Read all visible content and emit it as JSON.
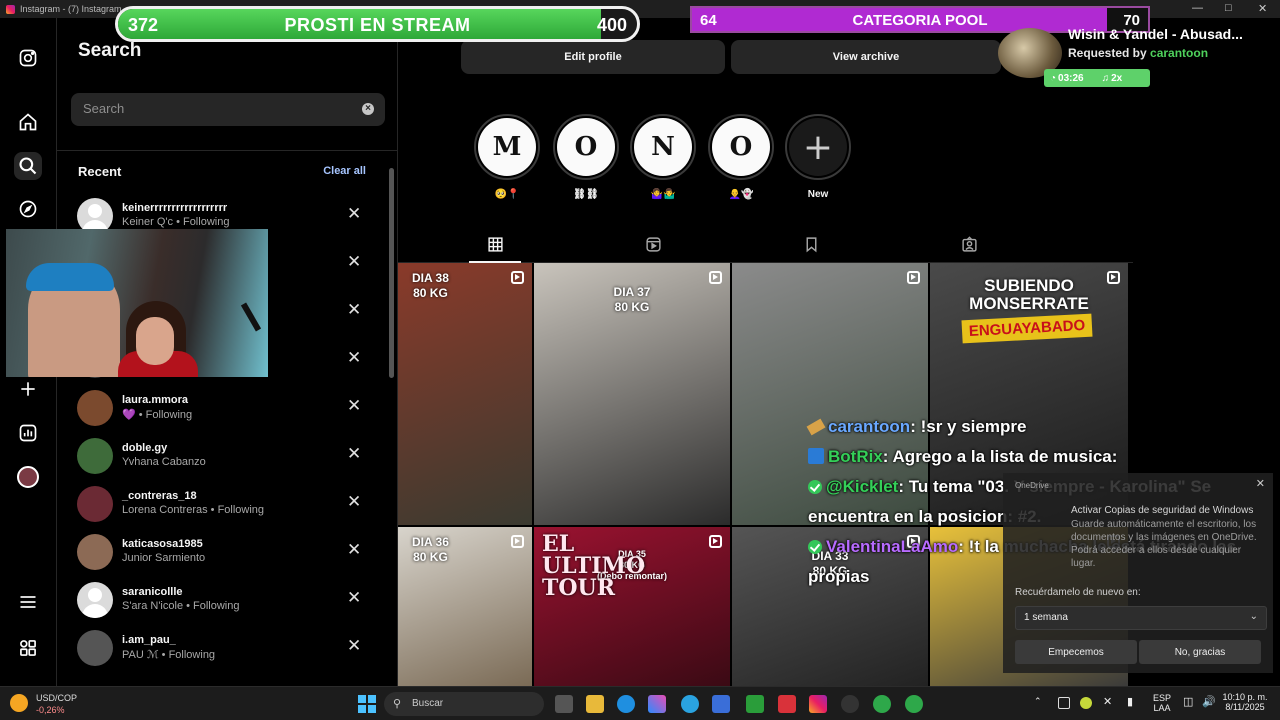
{
  "window": {
    "title": "Instagram - (7) Instagram"
  },
  "search": {
    "title": "Search",
    "placeholder": "Search",
    "recent_label": "Recent",
    "clear_all": "Clear all"
  },
  "recents": [
    {
      "username": "keinerrrrrrrrrrrrrrrrrr",
      "sub": "Keiner Q'c • Following",
      "avatar_color": "#dbdbdb",
      "default": true
    },
    {
      "username": "",
      "sub": "",
      "avatar_color": "#444444"
    },
    {
      "username": "",
      "sub": "",
      "avatar_color": "#444444"
    },
    {
      "username": "",
      "sub": "",
      "avatar_color": "#444444"
    },
    {
      "username": "laura.mmora",
      "sub": "💜 • Following",
      "avatar_color": "#7b4a2e"
    },
    {
      "username": "doble.gy",
      "sub": "Yvhana Cabanzo",
      "avatar_color": "#3e6b3a"
    },
    {
      "username": "_contreras_18",
      "sub": "Lorena Contreras • Following",
      "avatar_color": "#6b2a34"
    },
    {
      "username": "katicasosa1985",
      "sub": "Junior Sarmiento",
      "avatar_color": "#8c6a55"
    },
    {
      "username": "saranicollle",
      "sub": "S'ara N'icole • Following",
      "avatar_color": "#dbdbdb",
      "default": true
    },
    {
      "username": "i.am_pau_",
      "sub": "PAU ℳ • Following",
      "avatar_color": "#555555"
    }
  ],
  "profile": {
    "edit_profile": "Edit profile",
    "view_archive": "View archive",
    "highlights": [
      {
        "letter": "M",
        "label": "🥺📍"
      },
      {
        "letter": "O",
        "label": "⛓⛓"
      },
      {
        "letter": "N",
        "label": "🤷‍♀️🤷‍♂️"
      },
      {
        "letter": "O",
        "label": "👩‍🦲👻"
      },
      {
        "letter": "+",
        "label": "New"
      }
    ],
    "grid": [
      {
        "caption": "DIA 38\n80 KG",
        "color1": "#8a3a2a",
        "color2": "#3a3a30"
      },
      {
        "caption": "DIA 37\n80 KG",
        "color1": "#c9c4bc",
        "color2": "#2b2b2b"
      },
      {
        "caption": "",
        "color1": "#8b8b8b",
        "color2": "#3c4a3e"
      },
      {
        "caption": "SUBIENDO\nMONSERRATE",
        "caption2": "ENGUAYABADO",
        "color1": "#4a4a4a",
        "color2": "#1a1a1a"
      },
      {
        "caption": "DIA 36\n80 KG",
        "color1": "#d8d4cc",
        "color2": "#7a6a55"
      },
      {
        "caption": "DIA 35\n80 KG\n(Debo remontar)",
        "caption2": "EL ULTIMO TOUR",
        "color1": "#9a1230",
        "color2": "#3a0a14"
      },
      {
        "caption": "DIA 33\n80 KG",
        "color1": "#555555",
        "color2": "#222222"
      },
      {
        "caption": "",
        "color1": "#e8c13a",
        "color2": "#3a3a3a"
      }
    ]
  },
  "overlays": {
    "prosti": {
      "left": "372",
      "title": "PROSTI EN STREAM",
      "right": "400",
      "progress": 0.93
    },
    "pool": {
      "left": "64",
      "title": "CATEGORIA POOL",
      "right": "70",
      "progress": 0.91
    },
    "song": {
      "title": "Wisin & Yandel - Abusad...",
      "requested_prefix": "Requested by ",
      "requested_by": "carantoon",
      "time": "03:26",
      "count": "2x"
    },
    "chat": [
      {
        "user": "carantoon",
        "user_color": "#6aa8ff",
        "icon": "wrench",
        "text": ": !sr y siempre"
      },
      {
        "user": "BotRix",
        "user_color": "#34d058",
        "icon": "bot",
        "text": ": Agrego a la lista de musica:"
      },
      {
        "user": "@Kicklet",
        "user_color": "#34d058",
        "icon": "badge",
        "text": ": Tu tema \"03. Y siempre - Karolina\" Se encuentra en la posicion: #2."
      },
      {
        "user": "ValentinaLaAmo",
        "user_color": "#b86bff",
        "icon": "badge",
        "text": ": !t la muchacha le está tirando las propias"
      }
    ]
  },
  "notification": {
    "app": "OneDrive",
    "title": "Activar Copias de seguridad de Windows",
    "body": "Guarde automáticamente el escritorio, los documentos y las imágenes en OneDrive. Podrá acceder a ellos desde cualquier lugar.",
    "remind_label": "Recuérdamelo de nuevo en:",
    "remind_value": "1 semana",
    "btn_primary": "Empecemos",
    "btn_secondary": "No, gracias"
  },
  "taskbar": {
    "stock_name": "USD/COP",
    "stock_value": "-0,26%",
    "search": "Buscar",
    "lang1": "ESP",
    "lang2": "LAA",
    "time": "10:10 p. m.",
    "date": "8/11/2025"
  }
}
